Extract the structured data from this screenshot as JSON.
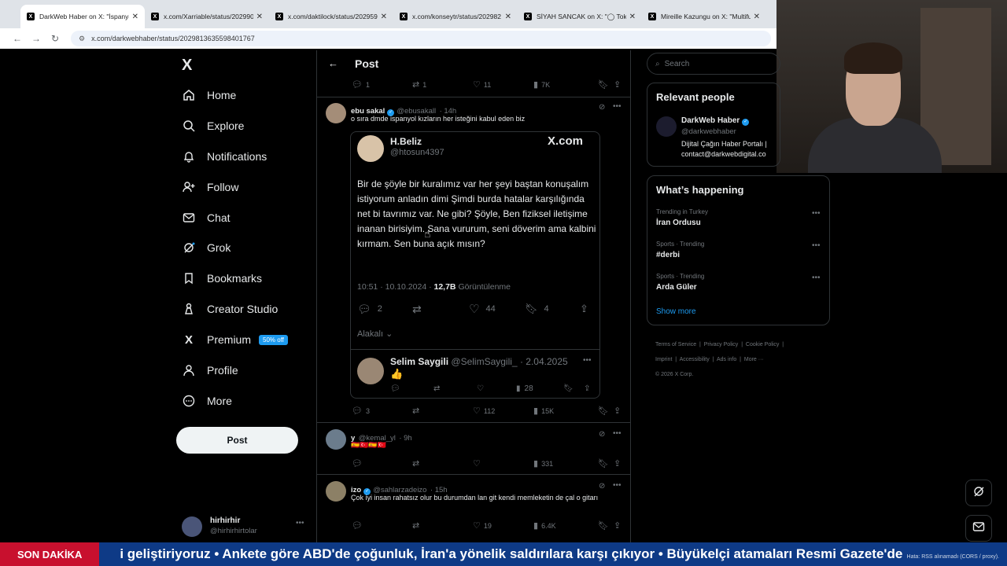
{
  "browser": {
    "tabs": [
      {
        "title": "DarkWeb Haber on X: \"İspanya",
        "active": true
      },
      {
        "title": "x.com/Xarriable/status/202990",
        "active": false
      },
      {
        "title": "x.com/daktilock/status/202959",
        "active": false
      },
      {
        "title": "x.com/konseytr/status/202982",
        "active": false
      },
      {
        "title": "SİYAH SANCAK on X: \"◯ Toka",
        "active": false
      },
      {
        "title": "Mireille Kazungu on X: \"Multifu",
        "active": false
      }
    ],
    "url": "x.com/darkwebhaber/status/2029813635598401767"
  },
  "sidebar": {
    "logo": "X",
    "items": [
      {
        "label": "Home",
        "icon": "home-icon"
      },
      {
        "label": "Explore",
        "icon": "search-icon"
      },
      {
        "label": "Notifications",
        "icon": "bell-icon"
      },
      {
        "label": "Follow",
        "icon": "add-person-icon"
      },
      {
        "label": "Chat",
        "icon": "mail-icon"
      },
      {
        "label": "Grok",
        "icon": "grok-icon"
      },
      {
        "label": "Bookmarks",
        "icon": "bookmark-icon"
      },
      {
        "label": "Creator Studio",
        "icon": "creator-icon"
      },
      {
        "label": "Premium",
        "icon": "x-icon"
      },
      {
        "label": "Profile",
        "icon": "person-icon"
      },
      {
        "label": "More",
        "icon": "more-circle-icon"
      }
    ],
    "premium_badge": "50% off",
    "post_button": "Post",
    "account": {
      "name": "hirhirhir",
      "handle": "@hirhirhirtolar"
    }
  },
  "main": {
    "header_title": "Post",
    "top_actions": {
      "replies": "1",
      "reposts": "1",
      "likes": "11",
      "views": "7K"
    },
    "tweets": [
      {
        "name": "ebu sakal",
        "handle": "@ebusakall",
        "time": "· 14h",
        "text": "o sıra dmde ispanyol kızların her isteğini kabul eden biz",
        "actions": {
          "replies": "3",
          "reposts": "",
          "likes": "112",
          "views": "15K"
        }
      },
      {
        "name": "y",
        "handle": "@kemal_yl",
        "time": "· 9h",
        "text": "🇪🇸🇹🇷🇪🇸🇹🇷",
        "actions": {
          "replies": "",
          "reposts": "",
          "likes": "",
          "views": "331"
        }
      },
      {
        "name": "izo",
        "handle": "@sahlarzadeizo",
        "time": "· 15h",
        "text": "Çok iyi insan rahatsız olur bu durumdan lan git kendi memleketin de çal o gitarı",
        "actions": {
          "replies": "",
          "reposts": "",
          "likes": "19",
          "views": "6.4K"
        }
      }
    ],
    "card": {
      "author_name": "H.Beliz",
      "author_handle": "@htosun4397",
      "brand": "X.com",
      "text": "Bir de şöyle bir kuralımız var her şeyi baştan konuşalım istiyorum anladın dimi Şimdi burda hatalar karşılığında net bi tavrımız var. Ne gibi? Şöyle, Ben fiziksel iletişime inanan birisiyim. Sana vururum, seni döverim ama kalbini kırmam. Sen buna açık mısın?",
      "time": "10:51 · 10.10.2024 ·",
      "views_count": "12,7B",
      "views_label": "Görüntülenme",
      "actions": {
        "replies": "2",
        "likes": "44",
        "bookmarks": "4"
      },
      "related_label": "Alakalı",
      "reply": {
        "name": "Selim Saygili",
        "handle": "@SelimSaygili_",
        "date": "· 2.04.2025",
        "text": "👍",
        "views": "28"
      }
    }
  },
  "right": {
    "search_placeholder": "Search",
    "relevant_title": "Relevant people",
    "relevant": {
      "name": "DarkWeb Haber",
      "handle": "@darkwebhaber",
      "bio_line1": "Dijital Çağın Haber Portalı |",
      "bio_line2": "contact@darkwebdigital.co"
    },
    "happening_title": "What’s happening",
    "trends": [
      {
        "meta": "Trending in Turkey",
        "name": "İran Ordusu"
      },
      {
        "meta": "Sports · Trending",
        "name": "#derbi"
      },
      {
        "meta": "Sports · Trending",
        "name": "Arda Güler"
      }
    ],
    "show_more": "Show more",
    "footer": {
      "links1": [
        "Terms of Service",
        "Privacy Policy",
        "Cookie Policy"
      ],
      "links2": [
        "Imprint",
        "Accessibility",
        "Ads info",
        "More ···"
      ],
      "copyright": "© 2026 X Corp."
    }
  },
  "ticker": {
    "label": "SON DAKİKA",
    "text": "i geliştiriyoruz    •  Ankete göre ABD'de çoğunluk, İran'a yönelik saldırılara karşı çıkıyor   •  Büyükelçi atamaları Resmi Gazete'de",
    "error": "Hata: RSS alınamadı (CORS / proxy)."
  },
  "colors": {
    "accent": "#1d9bf0",
    "ticker_bg": "#0e3a86",
    "ticker_label_bg": "#c8102e"
  }
}
